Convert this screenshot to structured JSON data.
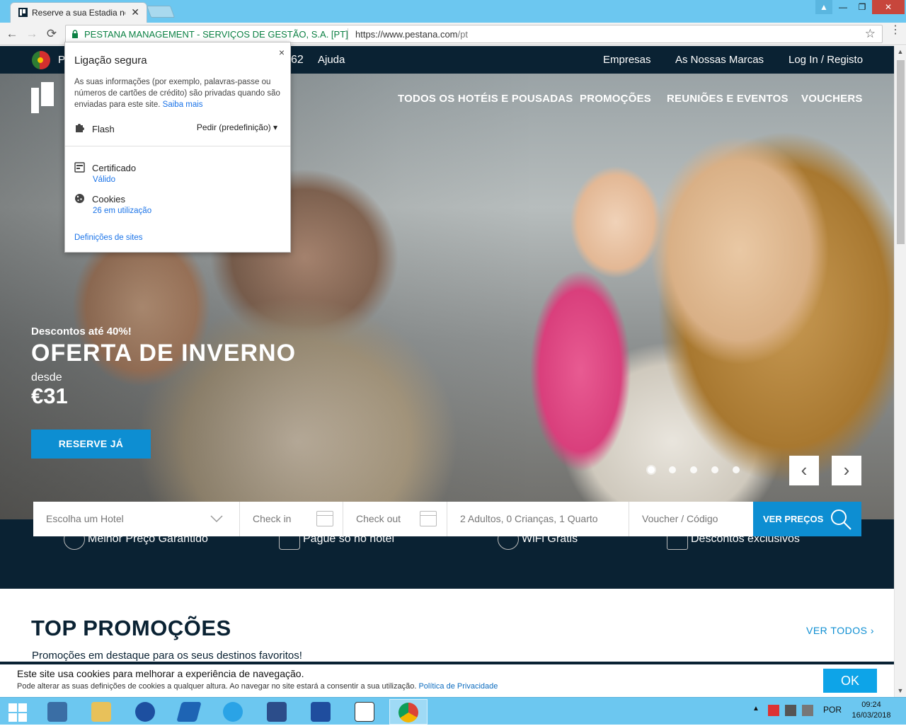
{
  "browser": {
    "tab_title": "Reserve a sua Estadia no",
    "tab_close": "✕",
    "window_buttons": [
      "▲",
      "—",
      "❐",
      "✕"
    ],
    "nav": {
      "back": "←",
      "forward": "→",
      "reload": "⟳"
    },
    "omnibox": {
      "org": "PESTANA MANAGEMENT - SERVIÇOS DE GESTÃO, S.A. [PT]",
      "url_scheme_host": "https://www.pestana.com",
      "url_path": "/pt",
      "star": "☆"
    },
    "menu": "⋮"
  },
  "site": {
    "topbar": {
      "lang_initial": "P",
      "phone_fragment": "62",
      "help": "Ajuda",
      "links": [
        "Empresas",
        "As Nossas Marcas",
        "Log In / Registo"
      ]
    },
    "mainnav": [
      "TODOS OS HOTÉIS E POUSADAS",
      "PROMOÇÕES",
      "REUNIÕES E EVENTOS",
      "VOUCHERS"
    ],
    "hero": {
      "subtitle": "Descontos até 40%!",
      "title": "OFERTA DE INVERNO",
      "from": "desde",
      "price": "€31",
      "cta": "RESERVE JÁ",
      "slides_total": 5,
      "active_slide": 1,
      "prev": "‹",
      "next": "›"
    },
    "search": {
      "hotel_placeholder": "Escolha um Hotel",
      "checkin": "Check in",
      "checkout": "Check out",
      "guests": "2 Adultos, 0 Crianças, 1 Quarto",
      "voucher": "Voucher / Código",
      "button": "VER PREÇOS"
    },
    "features": [
      "Melhor Preço Garantido",
      "Pague só no hotel",
      "WiFi Grátis",
      "Descontos exclusivos"
    ],
    "section": {
      "title": "TOP PROMOÇÕES",
      "subtitle": "Promoções em destaque para os seus destinos favoritos!",
      "see_all": "VER TODOS ›"
    },
    "cookie": {
      "line1": "Este site usa cookies para melhorar a experiência de navegação.",
      "line2": "Pode alterar as suas definições de cookies a qualquer altura. Ao navegar no site estará a consentir a sua utilização.",
      "privacy_link": "Política de Privacidade",
      "ok": "OK"
    }
  },
  "popup": {
    "title": "Ligação segura",
    "close": "×",
    "description": "As suas informações (por exemplo, palavras-passe ou números de cartões de crédito) são privadas quando são enviadas para este site.",
    "learn_more": "Saiba mais",
    "flash_label": "Flash",
    "flash_value": "Pedir (predefinição) ▾",
    "certificate_label": "Certificado",
    "certificate_value": "Válido",
    "cookies_label": "Cookies",
    "cookies_value": "26 em utilização",
    "site_settings": "Definições de sites"
  },
  "taskbar": {
    "tray": {
      "lang": "POR"
    },
    "clock": {
      "time": "09:24",
      "date": "16/03/2018"
    }
  },
  "colors": {
    "brand_navy": "#0a2233",
    "brand_blue": "#0d8ed2",
    "title_bar": "#6cc7f0"
  }
}
